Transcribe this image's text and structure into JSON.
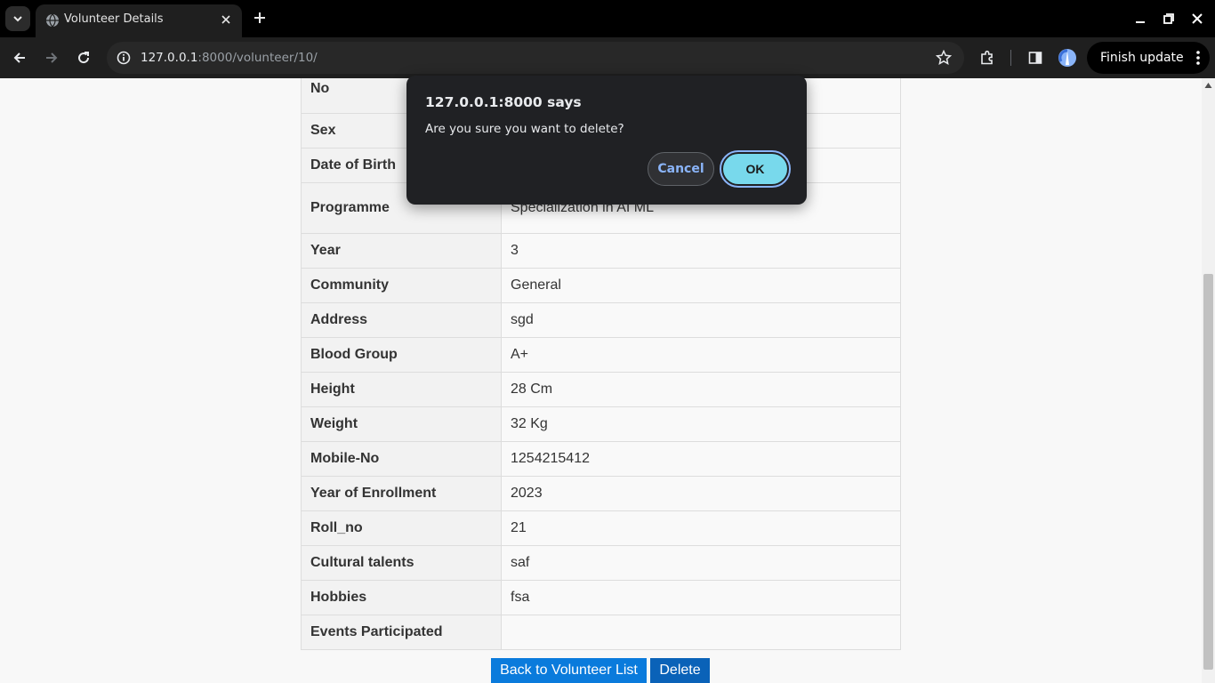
{
  "browser": {
    "tab_title": "Volunteer Details",
    "url_host": "127.0.0.1",
    "url_rest": ":8000/volunteer/10/",
    "finish_update_label": "Finish update"
  },
  "details": [
    {
      "label": "Fathers/Guardian Mobile No",
      "value": "",
      "height": 0
    },
    {
      "label": "Sex",
      "value": ""
    },
    {
      "label": "Date of Birth",
      "value": ""
    },
    {
      "label": "Programme",
      "value": "Specialization in AI ML"
    },
    {
      "label": "Year",
      "value": "3"
    },
    {
      "label": "Community",
      "value": "General"
    },
    {
      "label": "Address",
      "value": "sgd"
    },
    {
      "label": "Blood Group",
      "value": "A+"
    },
    {
      "label": "Height",
      "value": "28 Cm"
    },
    {
      "label": "Weight",
      "value": "32 Kg"
    },
    {
      "label": "Mobile-No",
      "value": "1254215412"
    },
    {
      "label": "Year of Enrollment",
      "value": "2023"
    },
    {
      "label": "Roll_no",
      "value": "21"
    },
    {
      "label": "Cultural talents",
      "value": "saf"
    },
    {
      "label": "Hobbies",
      "value": "fsa"
    },
    {
      "label": "Events Participated",
      "value": ""
    }
  ],
  "actions": {
    "back_label": "Back to Volunteer List",
    "delete_label": "Delete"
  },
  "dialog": {
    "title": "127.0.0.1:8000 says",
    "message": "Are you sure you want to delete?",
    "cancel_label": "Cancel",
    "ok_label": "OK"
  }
}
